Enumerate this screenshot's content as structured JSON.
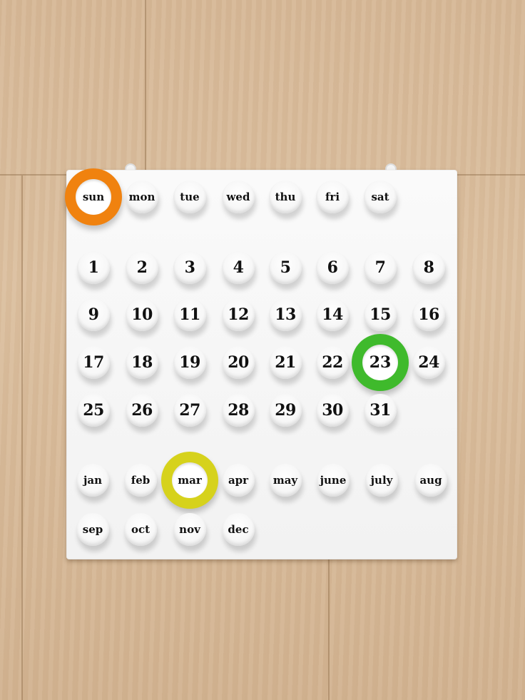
{
  "weekdays": [
    "sun",
    "mon",
    "tue",
    "wed",
    "thu",
    "fri",
    "sat"
  ],
  "days": [
    "1",
    "2",
    "3",
    "4",
    "5",
    "6",
    "7",
    "8",
    "9",
    "10",
    "11",
    "12",
    "13",
    "14",
    "15",
    "16",
    "17",
    "18",
    "19",
    "20",
    "21",
    "22",
    "23",
    "24",
    "25",
    "26",
    "27",
    "28",
    "29",
    "30",
    "31"
  ],
  "months": [
    "jan",
    "feb",
    "mar",
    "apr",
    "may",
    "june",
    "july",
    "aug",
    "sep",
    "oct",
    "nov",
    "dec"
  ],
  "selected": {
    "weekday": "sun",
    "day": "23",
    "month": "mar"
  },
  "colors": {
    "weekday_ring": "#f0820f",
    "day_ring": "#3fba2c",
    "month_ring": "#d6d21c",
    "board": "#f6f6f6",
    "wood": "#d6b897"
  }
}
